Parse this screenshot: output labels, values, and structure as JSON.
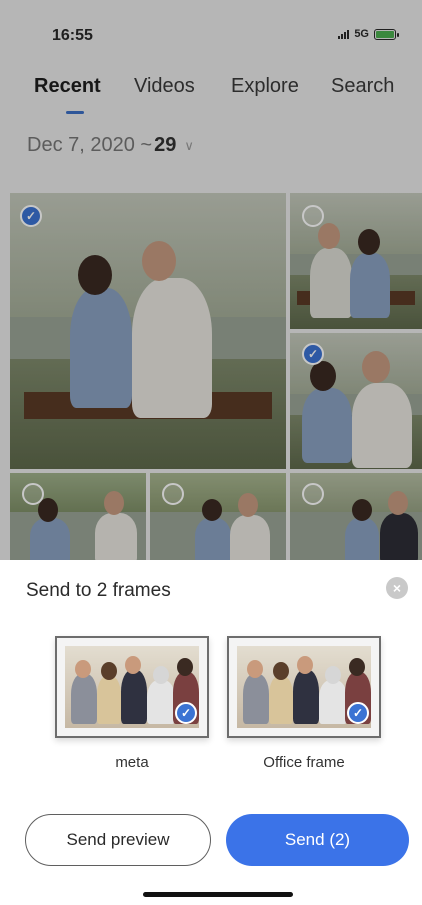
{
  "status": {
    "time": "16:55",
    "network": "5G"
  },
  "tabs": [
    {
      "label": "Recent",
      "active": true
    },
    {
      "label": "Videos",
      "active": false
    },
    {
      "label": "Explore",
      "active": false
    },
    {
      "label": "Search",
      "active": false
    }
  ],
  "date_range": {
    "month_day": "Dec 7, 2020 ~",
    "end_day": "29"
  },
  "photos": [
    {
      "selected": true
    },
    {
      "selected": false
    },
    {
      "selected": true
    },
    {
      "selected": false
    },
    {
      "selected": false
    },
    {
      "selected": false
    }
  ],
  "sheet": {
    "title": "Send to 2 frames",
    "frames": [
      {
        "name": "meta",
        "selected": true
      },
      {
        "name": "Office frame",
        "selected": true
      }
    ],
    "preview_button": "Send preview",
    "send_button": "Send (2)"
  },
  "colors": {
    "accent": "#3b73e8",
    "check": "#3b73d3",
    "underline": "#3b6fc4"
  }
}
